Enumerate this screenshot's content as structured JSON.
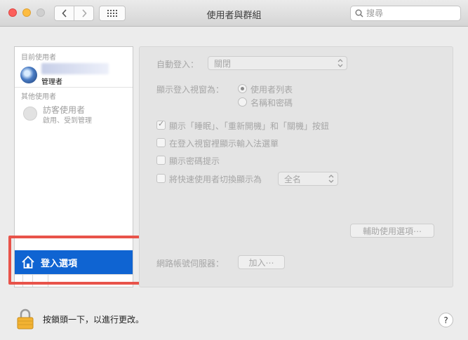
{
  "window": {
    "title": "使用者與群組"
  },
  "toolbar": {
    "search_placeholder": "搜尋"
  },
  "sidebar": {
    "current_users_label": "目前使用者",
    "admin": {
      "role": "管理者"
    },
    "other_users_label": "其他使用者",
    "guest": {
      "name": "訪客使用者",
      "status": "啟用、受到管理"
    },
    "login_options_label": "登入選項"
  },
  "login": {
    "auto_login_label": "自動登入：",
    "auto_login_value": "關閉",
    "display_window_label": "顯示登入視窗為：",
    "radio_user_list": "使用者列表",
    "radio_name_password": "名稱和密碼",
    "check_sleep_restart": "顯示「睡眠」、「重新開機」和「關機」按鈕",
    "check_input_menu": "在登入視窗裡顯示輸入法選單",
    "check_password_hint": "顯示密碼提示",
    "check_fast_switch": "將快速使用者切換顯示為",
    "fast_switch_value": "全名",
    "accessibility_button": "輔助使用選項⋯",
    "network_server_label": "網路帳號伺服器：",
    "join_button": "加入⋯"
  },
  "footer": {
    "lock_text": "按鎖頭一下，以進行更改。",
    "help_label": "?"
  }
}
